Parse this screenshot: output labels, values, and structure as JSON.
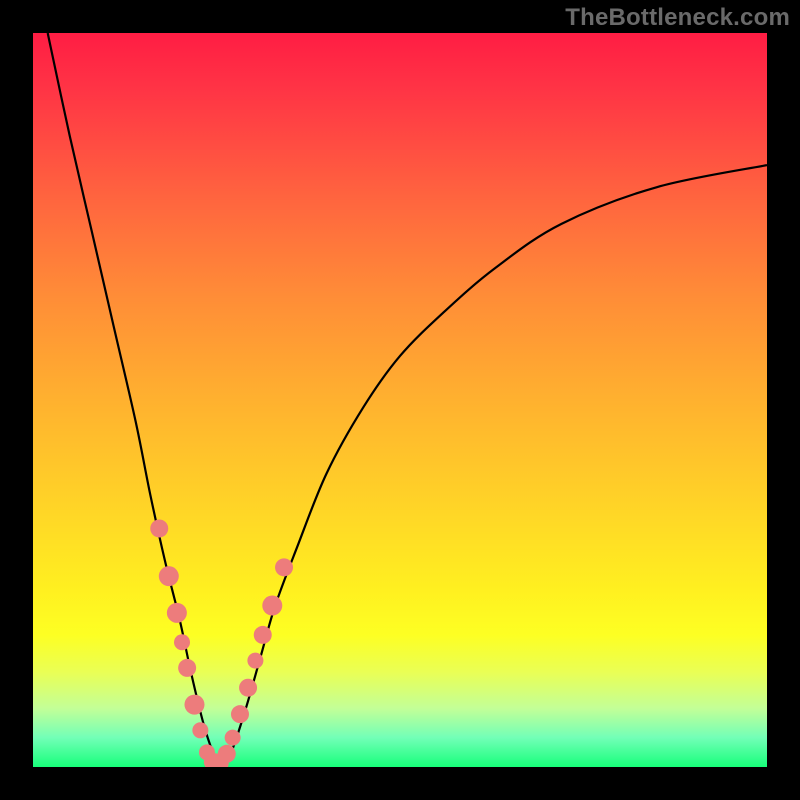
{
  "watermark": "TheBottleneck.com",
  "colors": {
    "frame": "#000000",
    "curve": "#000000",
    "bead": "#ed7c7c",
    "gradient_top": "#ff1d44",
    "gradient_bottom": "#17ff7a"
  },
  "chart_data": {
    "type": "line",
    "title": "",
    "xlabel": "",
    "ylabel": "",
    "xlim": [
      0,
      100
    ],
    "ylim": [
      0,
      100
    ],
    "annotations": [
      "TheBottleneck.com"
    ],
    "series": [
      {
        "name": "bottleneck-curve",
        "x": [
          2,
          5,
          8,
          11,
          14,
          16,
          18,
          20,
          21.5,
          23.2,
          24.5,
          25.5,
          27,
          29,
          31,
          33,
          36,
          40,
          45,
          50,
          56,
          63,
          72,
          85,
          100
        ],
        "y": [
          100,
          86,
          73,
          60,
          47,
          37,
          28,
          20,
          13,
          6,
          2,
          0,
          2,
          8,
          15,
          22,
          30,
          40,
          49,
          56,
          62,
          68,
          74,
          79,
          82
        ]
      }
    ],
    "markers": {
      "name": "highlight-beads",
      "x": [
        17.2,
        18.5,
        19.6,
        20.3,
        21.0,
        22.0,
        22.8,
        23.7,
        24.5,
        25.3,
        26.4,
        27.2,
        28.2,
        29.3,
        30.3,
        31.3,
        32.6,
        34.2
      ],
      "y": [
        32.5,
        26.0,
        21.0,
        17.0,
        13.5,
        8.5,
        5.0,
        2.0,
        0.7,
        0.5,
        1.8,
        4.0,
        7.2,
        10.8,
        14.5,
        18.0,
        22.0,
        27.2
      ],
      "r": [
        9,
        10,
        10,
        8,
        9,
        10,
        8,
        8,
        9,
        10,
        9,
        8,
        9,
        9,
        8,
        9,
        10,
        9
      ]
    }
  }
}
